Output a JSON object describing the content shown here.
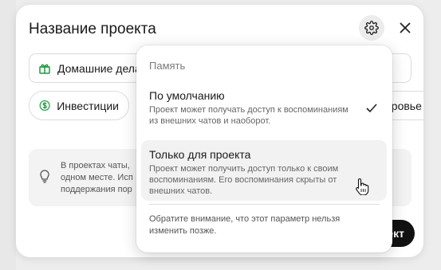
{
  "modal": {
    "title": "Название проекта",
    "settings_icon": "gear-icon",
    "close_icon": "close-icon"
  },
  "chips": {
    "home": "Домашние дела",
    "investments": "Инвестиции",
    "health_partial": "оровье"
  },
  "info": {
    "text": "В проектах чаты, одном месте. Исп поддержания пор"
  },
  "create_button": {
    "label_partial": "ект"
  },
  "memory_dropdown": {
    "header": "Память",
    "options": [
      {
        "title": "По умолчанию",
        "description": "Проект может получать доступ к воспоминаниям из внешних чатов и наоборот.",
        "selected": true
      },
      {
        "title": "Только для проекта",
        "description": "Проект может получить доступ только к своим воспоминаниям. Его воспоминания скрыты от внешних чатов.",
        "selected": false
      }
    ],
    "note": "Обратите внимание, что этот параметр нельзя изменить позже."
  }
}
